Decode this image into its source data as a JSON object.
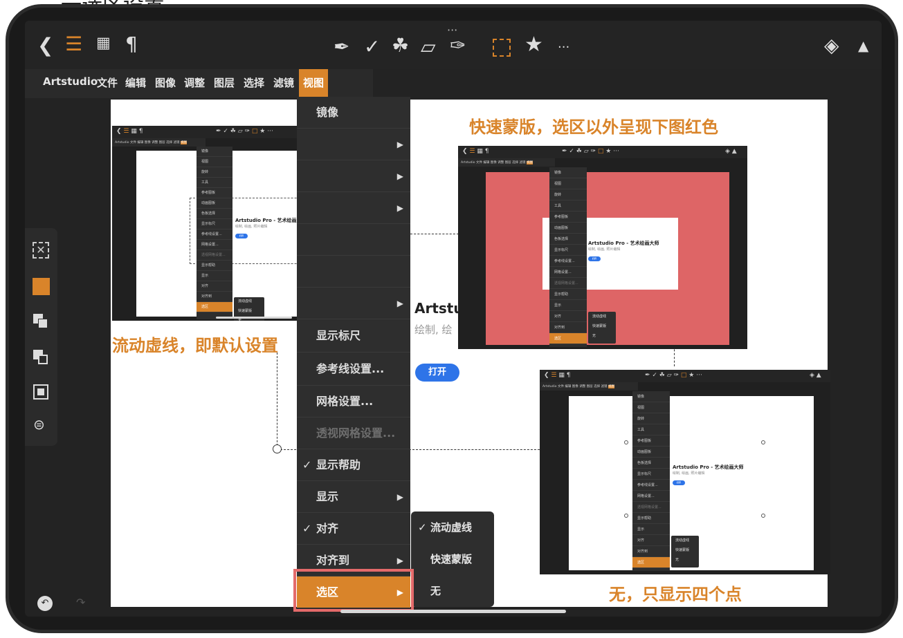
{
  "caption_top": "一选区设置",
  "app": {
    "menus": [
      "Artstudio",
      "文件",
      "编辑",
      "图像",
      "调整",
      "图层",
      "选择",
      "滤镜",
      "视图"
    ],
    "selected_menu": "视图",
    "more_dots": "···"
  },
  "view_menu": {
    "items": [
      {
        "label": "镜像"
      },
      {
        "label": "",
        "arrow": true
      },
      {
        "label": "",
        "arrow": true
      },
      {
        "label": "",
        "arrow": true
      },
      {
        "label": ""
      },
      {
        "label": ""
      },
      {
        "label": "",
        "arrow": true
      },
      {
        "label": "显示标尺"
      },
      {
        "label": "参考线设置..."
      },
      {
        "label": "网格设置..."
      },
      {
        "label": "透视网格设置...",
        "disabled": true
      },
      {
        "label": "显示帮助",
        "checked": true
      },
      {
        "label": "显示",
        "arrow": true
      },
      {
        "label": "对齐",
        "checked": true
      },
      {
        "label": "对齐到",
        "arrow": true
      },
      {
        "label": "选区",
        "arrow": true,
        "selected": true
      }
    ]
  },
  "selection_submenu": [
    {
      "label": "流动虚线",
      "checked": true
    },
    {
      "label": "快速蒙版",
      "checked": false
    },
    {
      "label": "无",
      "checked": false
    }
  ],
  "notes": {
    "flowing": "流动虚线，即默认设置",
    "quickmask": "快速蒙版，选区以外呈现下图红色",
    "none": "无，只显示四个点"
  },
  "card": {
    "title_partial": "Artstu",
    "sub_partial": "绘制, 绘",
    "open_button": "打开",
    "title": "Artstudio Pro - 艺术绘画大师",
    "sub": "绘制, 绘画, 照片编辑"
  },
  "thumb_menu": [
    "镜像",
    "视图",
    "旋转",
    "工具",
    "参考图板",
    "动画图板",
    "色板选择",
    "显示标尺",
    "参考线设置...",
    "网格设置...",
    "透视网格设置...",
    "显示帮助",
    "显示",
    "对齐",
    "对齐到",
    "选区"
  ],
  "thumb_sub": [
    "流动虚线",
    "快速蒙版",
    "无"
  ],
  "colors": {
    "accent": "#d9842a",
    "quickmask_red": "#de6566",
    "highlight_box": "#e46a6a",
    "button_blue": "#2e74e8"
  }
}
